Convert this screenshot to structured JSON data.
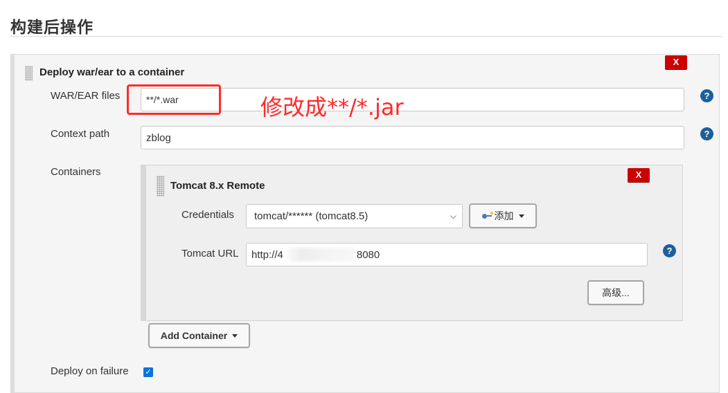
{
  "section": {
    "title": "构建后操作"
  },
  "deploy": {
    "title": "Deploy war/ear to a container",
    "remove_label": "X",
    "war_files": {
      "label": "WAR/EAR files",
      "value": "**/*.war"
    },
    "context_path": {
      "label": "Context path",
      "value": "zblog"
    },
    "containers_label": "Containers",
    "add_container_label": "Add Container",
    "deploy_on_failure": {
      "label": "Deploy on failure",
      "checked": true
    }
  },
  "annotation": {
    "text": "修改成**/*.jar",
    "color": "#ff2a2a"
  },
  "tomcat": {
    "title": "Tomcat 8.x Remote",
    "remove_label": "X",
    "credentials": {
      "label": "Credentials",
      "selected": "tomcat/****** (tomcat8.5)",
      "add_label": "添加"
    },
    "url": {
      "label": "Tomcat URL",
      "value_prefix": "http://4",
      "value_suffix": "8080"
    },
    "advanced_label": "高级..."
  },
  "help": {
    "symbol": "?"
  },
  "colors": {
    "remove_button": "#cc0000",
    "help_icon": "#1d5f9c",
    "checkbox": "#0a74da"
  }
}
